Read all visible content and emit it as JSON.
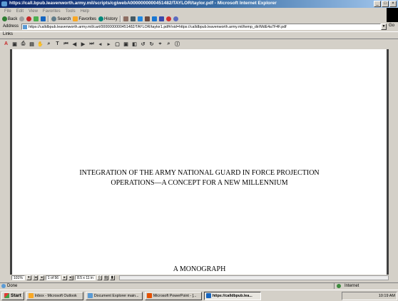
{
  "window": {
    "title": "https://call.bpub.leavenworth.army.mil/scripts/cgiwebA0000000000451482/TAYLOR/taylor.pdf - Microsoft Internet Explorer"
  },
  "menu": [
    "File",
    "Edit",
    "View",
    "Favorites",
    "Tools",
    "Help"
  ],
  "toolbar": {
    "back": "Back",
    "search": "Search",
    "favorites": "Favorites",
    "history": "History"
  },
  "address": {
    "label": "Address",
    "url": "https://calldbpub.leavenworth.army.mil/cart/0000000000451482/TAYLOR/taylor1.pdf#/xid=https://calldbpub.leavenworth.army.mil/temp_dir/MdE4a7F4F.pdf",
    "go": "Go"
  },
  "links": {
    "label": "Links"
  },
  "document": {
    "title_line1": "INTEGRATION OF THE ARMY NATIONAL GUARD IN FORCE PROJECTION",
    "title_line2": "OPERATIONS—A CONCEPT FOR A NEW MILLENNIUM",
    "subtitle": "A MONOGRAPH"
  },
  "viewer": {
    "zoom": "101%",
    "page": "1 of 56",
    "size": "8.5 x 11 in"
  },
  "status": {
    "text": "Done",
    "zone": "Internet"
  },
  "taskbar": {
    "start": "Start",
    "tasks": [
      {
        "label": "Inbox - Microsoft Outlook"
      },
      {
        "label": "Document Explorer main..."
      },
      {
        "label": "Microsoft PowerPoint - [..."
      },
      {
        "label": "https://calldbpub.lea..."
      }
    ],
    "clock": "10:19 AM"
  },
  "colors": {
    "titlebar": "#0a246a",
    "desktop_panel": "#d4d0c8",
    "page": "#ffffff"
  }
}
